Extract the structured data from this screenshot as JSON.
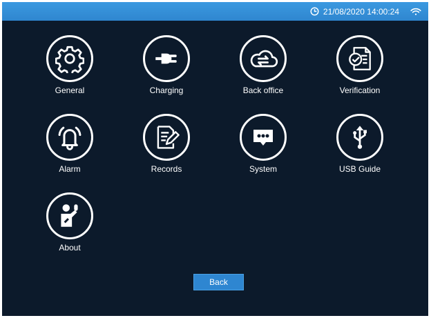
{
  "status_bar": {
    "clock_icon": "clock-icon",
    "datetime": "21/08/2020 14:00:24",
    "wifi_icon": "wifi-icon"
  },
  "menu": {
    "items": [
      {
        "label": "General",
        "icon": "gear-icon"
      },
      {
        "label": "Charging",
        "icon": "plug-icon"
      },
      {
        "label": "Back office",
        "icon": "cloud-sync-icon"
      },
      {
        "label": "Verification",
        "icon": "checked-document-icon"
      },
      {
        "label": "Alarm",
        "icon": "bell-icon"
      },
      {
        "label": "Records",
        "icon": "document-edit-icon"
      },
      {
        "label": "System",
        "icon": "chat-bubble-icon"
      },
      {
        "label": "USB Guide",
        "icon": "usb-icon"
      },
      {
        "label": "About",
        "icon": "person-info-icon"
      }
    ]
  },
  "footer": {
    "back_label": "Back"
  },
  "colors": {
    "background": "#0c1a2b",
    "topbar": "#3390d8",
    "button": "#2e86d1",
    "icon": "#ffffff"
  }
}
